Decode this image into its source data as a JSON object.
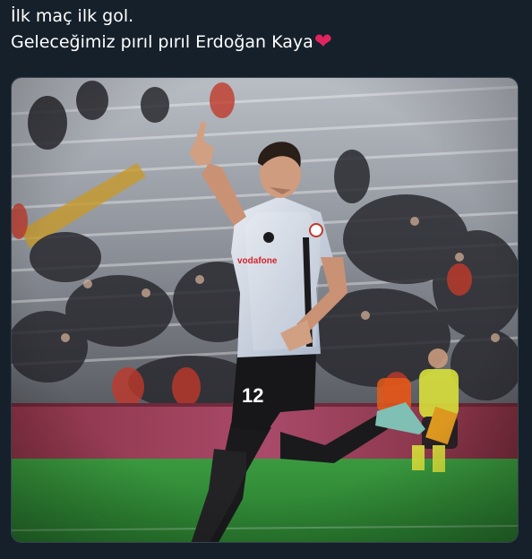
{
  "tweet": {
    "text_line_1": "İlk maç ilk gol.",
    "text_line_2": "Geleceğimiz pırıl pırıl Erdoğan Kaya",
    "emoji": "heart-emoji",
    "emoji_color": "#e0245e"
  },
  "photo": {
    "jersey_number": "12",
    "sponsor_text": "vodafone"
  },
  "colors": {
    "background": "#15202b",
    "text": "#ffffff",
    "pitch": "#2f8f3a"
  }
}
